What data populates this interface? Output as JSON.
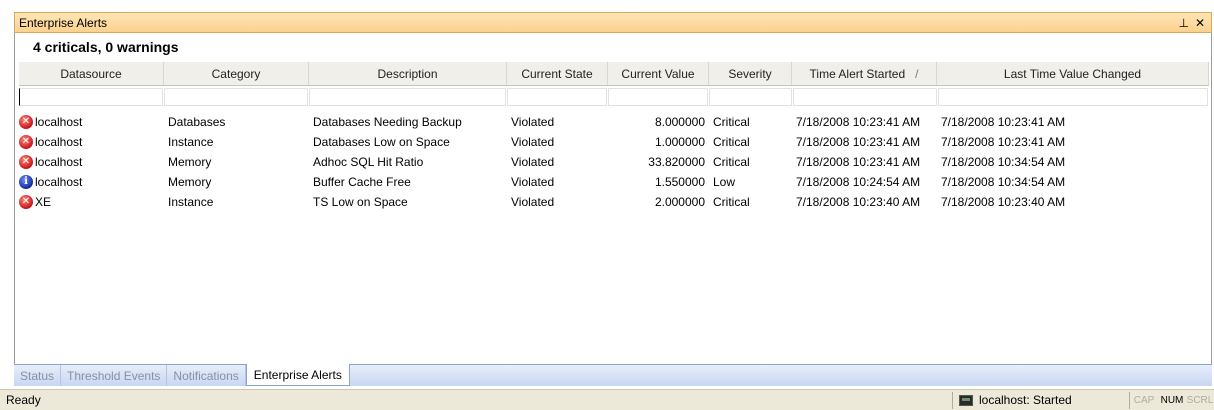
{
  "window": {
    "title": "Enterprise Alerts",
    "pin_glyph": "⊥",
    "close_glyph": "✕"
  },
  "summary": "4 criticals, 0 warnings",
  "grid": {
    "columns": [
      "Datasource",
      "Category",
      "Description",
      "Current State",
      "Current Value",
      "Severity",
      "Time Alert Started",
      "Last Time Value Changed"
    ],
    "sort_indicator": "/",
    "rows": [
      {
        "icon": "error-icon",
        "datasource": "localhost",
        "category": "Databases",
        "description": "Databases Needing Backup",
        "state": "Violated",
        "value": "8.000000",
        "severity": "Critical",
        "started": "7/18/2008 10:23:41 AM",
        "changed": "7/18/2008 10:23:41 AM"
      },
      {
        "icon": "error-icon",
        "datasource": "localhost",
        "category": "Instance",
        "description": "Databases Low on Space",
        "state": "Violated",
        "value": "1.000000",
        "severity": "Critical",
        "started": "7/18/2008 10:23:41 AM",
        "changed": "7/18/2008 10:23:41 AM"
      },
      {
        "icon": "error-icon",
        "datasource": "localhost",
        "category": "Memory",
        "description": "Adhoc SQL Hit Ratio",
        "state": "Violated",
        "value": "33.820000",
        "severity": "Critical",
        "started": "7/18/2008 10:23:41 AM",
        "changed": "7/18/2008 10:34:54 AM"
      },
      {
        "icon": "info-icon",
        "datasource": "localhost",
        "category": "Memory",
        "description": "Buffer Cache Free",
        "state": "Violated",
        "value": "1.550000",
        "severity": "Low",
        "started": "7/18/2008 10:24:54 AM",
        "changed": "7/18/2008 10:34:54 AM"
      },
      {
        "icon": "error-icon",
        "datasource": "XE",
        "category": "Instance",
        "description": "TS Low on Space",
        "state": "Violated",
        "value": "2.000000",
        "severity": "Critical",
        "started": "7/18/2008 10:23:40 AM",
        "changed": "7/18/2008 10:23:40 AM"
      }
    ]
  },
  "tabs": [
    "Status",
    "Threshold Events",
    "Notifications",
    "Enterprise Alerts"
  ],
  "active_tab": "Enterprise Alerts",
  "statusbar": {
    "ready": "Ready",
    "connection": "localhost: Started",
    "indicators": [
      {
        "label": "CAP",
        "on": false
      },
      {
        "label": "NUM",
        "on": true
      },
      {
        "label": "SCRL",
        "on": false
      }
    ]
  },
  "colors": {
    "title_bar": "#fbd18f",
    "critical_icon": "#c8141b",
    "info_icon": "#142a9c",
    "tab_strip": "#c8d6f2"
  }
}
